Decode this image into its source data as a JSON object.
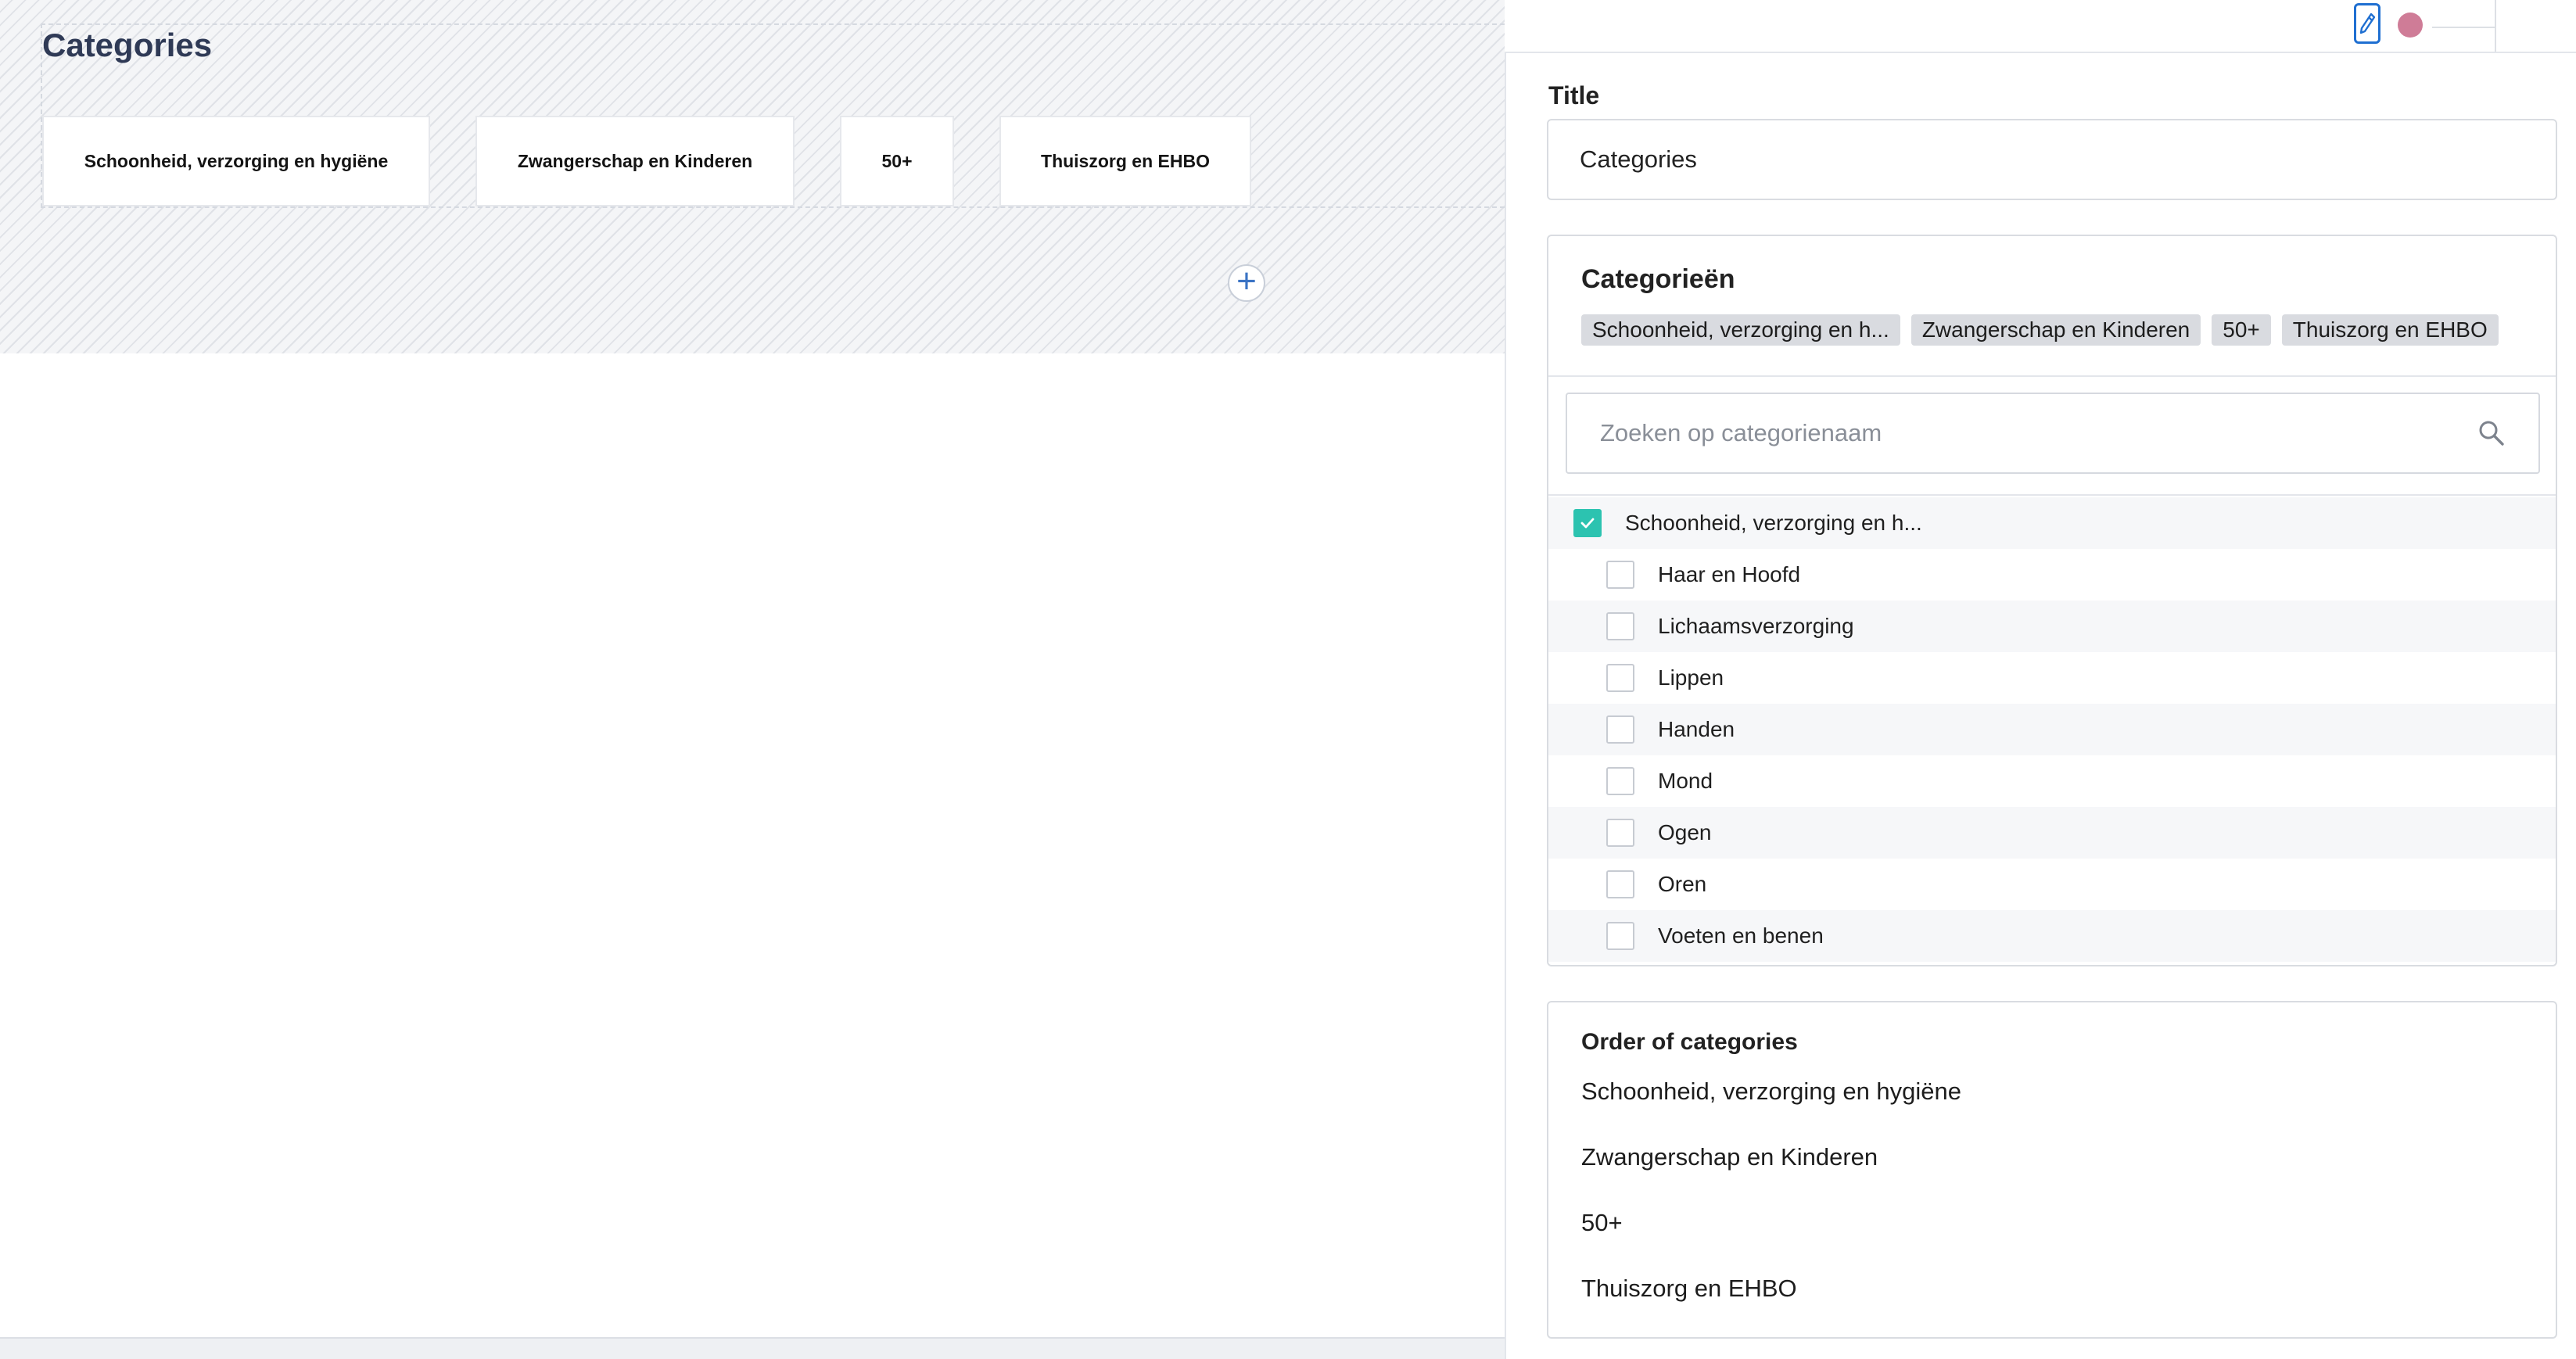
{
  "canvas": {
    "title": "Categories",
    "cards": [
      {
        "label": "Schoonheid, verzorging en hygiëne"
      },
      {
        "label": "Zwangerschap en Kinderen"
      },
      {
        "label": "50+"
      },
      {
        "label": "Thuiszorg en EHBO"
      }
    ],
    "add_symbol": "+"
  },
  "toolbar": {
    "edit_icon": "pencil-icon",
    "status_color": "#cf7c97"
  },
  "panel": {
    "title_label": "Title",
    "title_value": "Categories",
    "categories": {
      "heading": "Categorieën",
      "chips": [
        "Schoonheid, verzorging en h...",
        "Zwangerschap en Kinderen",
        "50+",
        "Thuiszorg en EHBO"
      ],
      "search_placeholder": "Zoeken op categorienaam",
      "search_icon": "search-icon",
      "tree": [
        {
          "label": "Schoonheid, verzorging en h...",
          "checked": true,
          "level": 0
        },
        {
          "label": "Haar en Hoofd",
          "checked": false,
          "level": 1
        },
        {
          "label": "Lichaamsverzorging",
          "checked": false,
          "level": 1
        },
        {
          "label": "Lippen",
          "checked": false,
          "level": 1
        },
        {
          "label": "Handen",
          "checked": false,
          "level": 1
        },
        {
          "label": "Mond",
          "checked": false,
          "level": 1
        },
        {
          "label": "Ogen",
          "checked": false,
          "level": 1
        },
        {
          "label": "Oren",
          "checked": false,
          "level": 1
        },
        {
          "label": "Voeten en benen",
          "checked": false,
          "level": 1
        }
      ]
    },
    "order": {
      "heading": "Order of categories",
      "items": [
        "Schoonheid, verzorging en hygiëne",
        "Zwangerschap en Kinderen",
        "50+",
        "Thuiszorg en EHBO"
      ]
    }
  },
  "colors": {
    "accent_check": "#2cc3b0",
    "edit_blue": "#1f6fd1",
    "title_dark": "#2f3a56"
  }
}
